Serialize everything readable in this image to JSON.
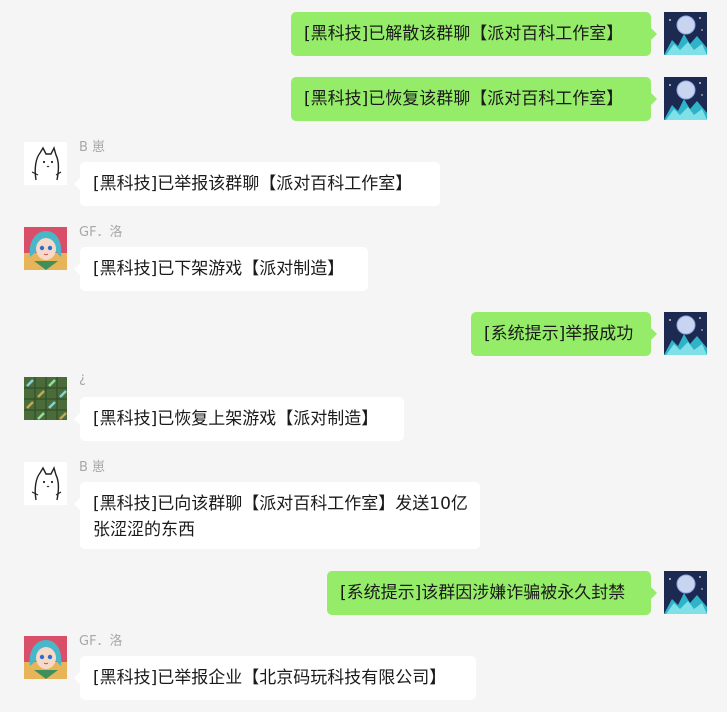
{
  "messages": [
    {
      "direction": "out",
      "avatar": "night-sky-avatar",
      "text": "[黑科技]已解散该群聊【派对百科工作室】"
    },
    {
      "direction": "out",
      "avatar": "night-sky-avatar",
      "text": "[黑科技]已恢复该群聊【派对百科工作室】"
    },
    {
      "direction": "in",
      "sender": "B  崽",
      "avatar": "cartoon-cat-avatar",
      "text": "[黑科技]已举报该群聊【派对百科工作室】"
    },
    {
      "direction": "in",
      "sender": "GF．洛",
      "avatar": "anime-girl-avatar",
      "text": "[黑科技]已下架游戏【派对制造】"
    },
    {
      "direction": "out",
      "avatar": "night-sky-avatar",
      "text": "[系统提示]举报成功"
    },
    {
      "direction": "in",
      "sender": "¿",
      "avatar": "pixel-grid-avatar",
      "text": "[黑科技]已恢复上架游戏【派对制造】"
    },
    {
      "direction": "in",
      "sender": "B  崽",
      "avatar": "cartoon-cat-avatar",
      "text": "[黑科技]已向该群聊【派对百科工作室】发送10亿张涩涩的东西"
    },
    {
      "direction": "out",
      "avatar": "night-sky-avatar",
      "text": "[系统提示]该群因涉嫌诈骗被永久封禁"
    },
    {
      "direction": "in",
      "sender": "GF．洛",
      "avatar": "anime-girl-avatar",
      "text": "[黑科技]已举报企业【北京码玩科技有限公司】"
    }
  ],
  "colors": {
    "background": "#f5f5f5",
    "incoming_bubble": "#ffffff",
    "outgoing_bubble": "#95ec69",
    "sender_name": "#a8a8a8"
  }
}
